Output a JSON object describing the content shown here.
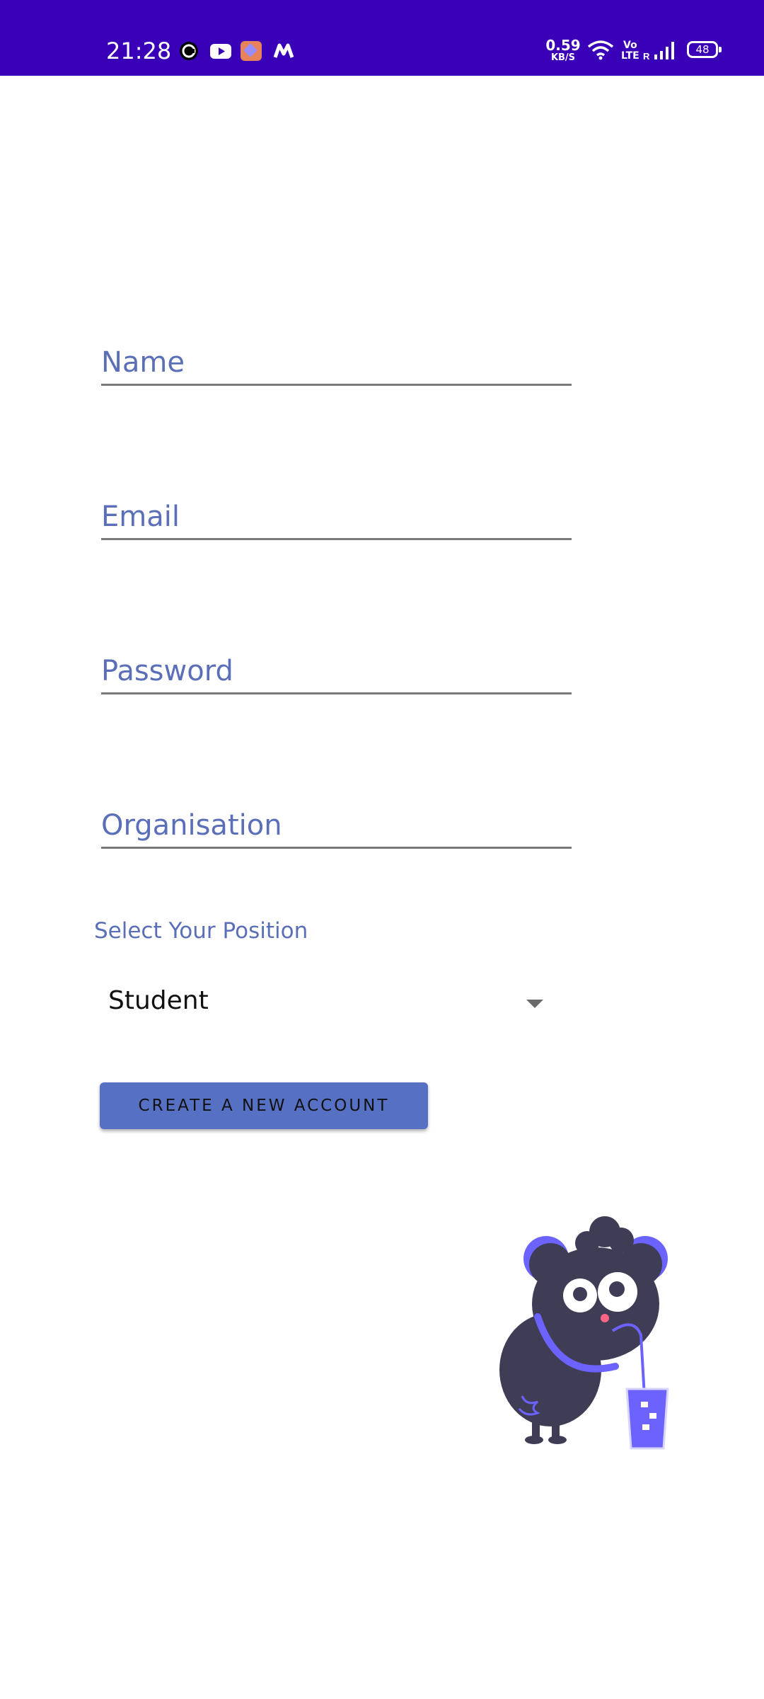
{
  "status_bar": {
    "time": "21:28",
    "net_speed_value": "0.59",
    "net_speed_unit": "KB/S",
    "volte_top": "Vo",
    "volte_bottom": "LTE",
    "roaming": "R",
    "battery": "48",
    "notification_icons": [
      "app-c-icon",
      "youtube-icon",
      "shortcut-app-icon",
      "m-app-icon"
    ],
    "system_icons": [
      "wifi-icon",
      "volte-icon",
      "signal-icon",
      "battery-icon"
    ],
    "background_color": "#3a00b8"
  },
  "form": {
    "name_placeholder": "Name",
    "email_placeholder": "Email",
    "password_placeholder": "Password",
    "organisation_placeholder": "Organisation",
    "position_label": "Select Your Position",
    "position_selected": "Student",
    "submit_label": "CREATE A NEW ACCOUNT"
  },
  "illustration": {
    "name": "mascot-drinking-illustration"
  },
  "colors": {
    "accent": "#5670c3",
    "label": "#5a6fb8",
    "illustration_dark": "#3f3d56",
    "illustration_accent": "#6c63ff"
  }
}
